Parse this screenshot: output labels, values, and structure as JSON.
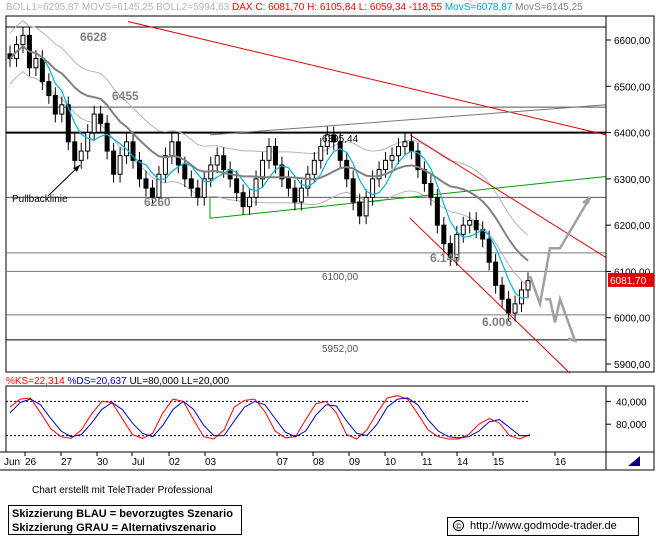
{
  "header": {
    "boll1_label": "BOLL1=6295,87",
    "movs_label": "MOVS=6145,25",
    "boll2_label": "BOLL2=5994,63",
    "dax_label": "DAX C: 6081,70",
    "high_label": "H: 6105,84",
    "low_label": "L: 6059,34",
    "change_label": "-118,55",
    "movs2_label": "MovS=6078,87",
    "movs3_label": "MovS=6145,25"
  },
  "price_axis": {
    "ticks": [
      "6600,00",
      "6500,00",
      "6400,00",
      "6300,00",
      "6200,00",
      "6100,00",
      "6000,00",
      "5900,00"
    ],
    "last_price": "6081,70"
  },
  "oscillator": {
    "header": {
      "ks": "%KS=22,314",
      "ds": "%DS=20,637",
      "ul": "UL=80,000",
      "ll": "LL=20,000"
    },
    "ticks": [
      "80,000",
      "40,000"
    ],
    "upper_level": 80,
    "lower_level": 20
  },
  "x_axis": {
    "labels": [
      "Jun",
      "26",
      "27",
      "30",
      "Jul",
      "02",
      "03",
      "07",
      "08",
      "09",
      "10",
      "11",
      "14",
      "15",
      "16"
    ]
  },
  "annotations": {
    "level_6628": "6628",
    "level_6455": "6455",
    "level_6260": "6260",
    "level_6395": "6395,44",
    "level_6140": "6.140",
    "level_6006": "6.006",
    "level_6100": "6100,00",
    "level_5952": "5952,00",
    "pullback": "Pullbacklinie"
  },
  "footer": {
    "credit": "Chart erstellt mit TeleTrader Professional",
    "legend_blue": "Skizzierung BLAU = bevorzugtes Szenario",
    "legend_gray": "Skizzierung GRAU = Alternativszenario",
    "url": "http://www.godmode-trader.de",
    "copyright_icon": "copyright-icon"
  },
  "colors": {
    "candle": "#000000",
    "ma_cyan": "#00b4dc",
    "ma_gray": "#808080",
    "band": "#b4b4b4",
    "trend_red": "#e00000",
    "trend_green": "#00a000",
    "k_line": "#ff0000",
    "d_line": "#0000c8",
    "header_red": "#ff0000",
    "header_cyan": "#00a0c8"
  },
  "chart_data": [
    {
      "type": "candlestick",
      "title": "DAX",
      "ylim": [
        5880,
        6650
      ],
      "y_ticks": [
        5900,
        6000,
        6100,
        6200,
        6300,
        6400,
        6500,
        6600
      ],
      "x_labels": [
        "26",
        "27",
        "30",
        "Jul",
        "02",
        "03",
        "07",
        "08",
        "09",
        "10",
        "11",
        "14",
        "15",
        "16"
      ],
      "close_series": [
        6560,
        6590,
        6610,
        6540,
        6560,
        6510,
        6480,
        6440,
        6460,
        6380,
        6340,
        6360,
        6400,
        6440,
        6420,
        6360,
        6310,
        6350,
        6380,
        6340,
        6300,
        6280,
        6260,
        6310,
        6350,
        6380,
        6330,
        6300,
        6280,
        6260,
        6300,
        6330,
        6350,
        6320,
        6300,
        6270,
        6240,
        6260,
        6300,
        6340,
        6370,
        6330,
        6300,
        6280,
        6250,
        6280,
        6310,
        6340,
        6370,
        6395,
        6380,
        6340,
        6300,
        6250,
        6220,
        6260,
        6300,
        6320,
        6340,
        6350,
        6370,
        6380,
        6360,
        6320,
        6290,
        6260,
        6200,
        6160,
        6130,
        6180,
        6200,
        6210,
        6190,
        6170,
        6120,
        6070,
        6040,
        6010,
        6030,
        6060,
        6080
      ],
      "bands": {
        "upper": 6295.87,
        "middle": 6145.25,
        "lower": 5994.63
      },
      "moving_averages": [
        {
          "name": "MovS=6078,87",
          "last": 6078.87
        },
        {
          "name": "MovS=6145,25",
          "last": 6145.25
        }
      ],
      "horizontal_levels": [
        6628,
        6455,
        6400,
        6260,
        6140,
        6100,
        6006,
        5952
      ],
      "last": {
        "close": 6081.7,
        "high": 6105.84,
        "low": 6059.34,
        "change": -118.55
      }
    },
    {
      "type": "line",
      "title": "",
      "ylim": [
        0,
        100
      ],
      "y_ticks": [
        40,
        80
      ],
      "levels": {
        "UL": 80,
        "LL": 20
      },
      "series": [
        {
          "name": "%KS",
          "last": 22.314,
          "values": [
            70,
            84,
            86,
            60,
            32,
            18,
            15,
            30,
            58,
            80,
            78,
            50,
            22,
            15,
            24,
            60,
            84,
            80,
            48,
            18,
            14,
            30,
            70,
            82,
            84,
            62,
            28,
            16,
            18,
            48,
            76,
            80,
            60,
            22,
            14,
            30,
            60,
            86,
            90,
            84,
            58,
            30,
            18,
            14,
            14,
            22,
            40,
            50,
            42,
            20,
            14,
            22
          ]
        },
        {
          "name": "%DS",
          "last": 20.637,
          "values": [
            60,
            78,
            84,
            74,
            50,
            28,
            18,
            22,
            42,
            66,
            78,
            66,
            42,
            24,
            18,
            38,
            66,
            80,
            66,
            38,
            20,
            20,
            46,
            70,
            80,
            74,
            50,
            26,
            18,
            28,
            56,
            74,
            72,
            46,
            24,
            20,
            40,
            70,
            84,
            86,
            74,
            48,
            28,
            18,
            16,
            18,
            28,
            44,
            48,
            34,
            20,
            20
          ]
        }
      ]
    }
  ]
}
